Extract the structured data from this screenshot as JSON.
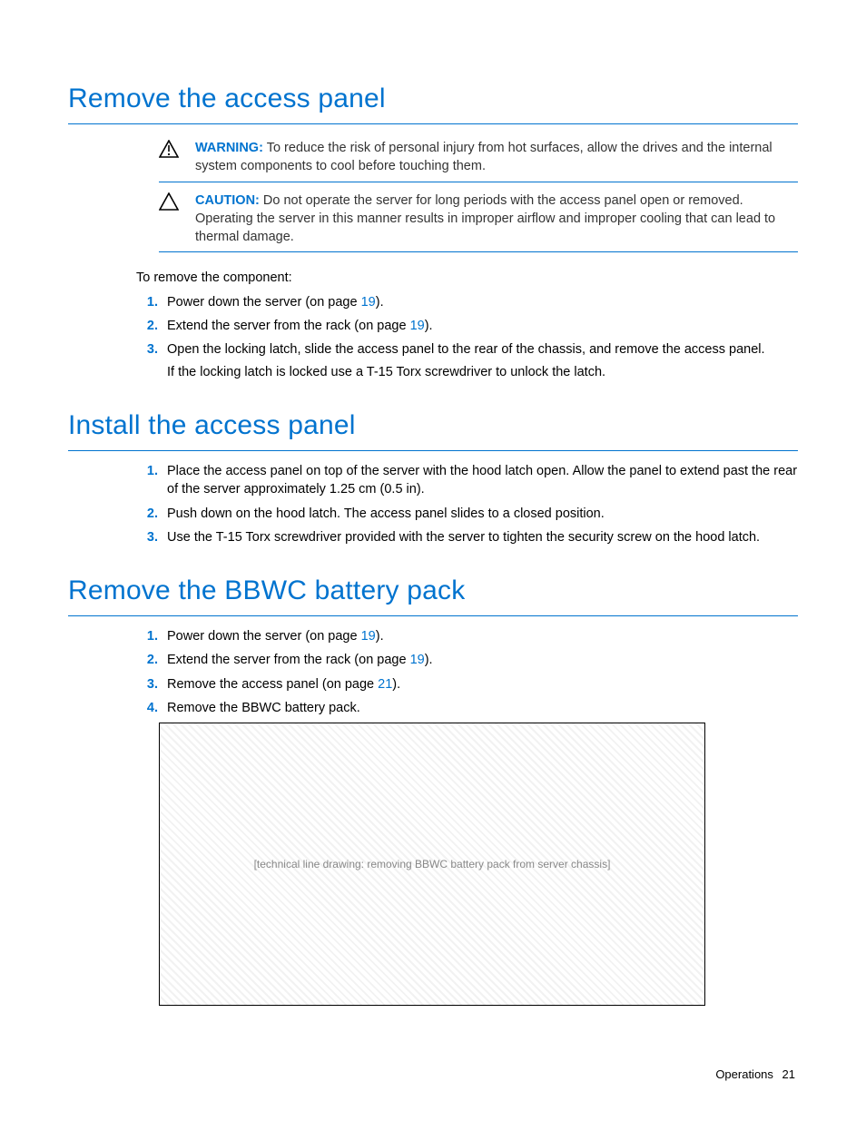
{
  "sections": {
    "remove_panel": {
      "heading": "Remove the access panel",
      "warning_label": "WARNING:",
      "warning_text": "To reduce the risk of personal injury from hot surfaces, allow the drives and the internal system components to cool before touching them.",
      "caution_label": "CAUTION:",
      "caution_text": "Do not operate the server for long periods with the access panel open or removed. Operating the server in this manner results in improper airflow and improper cooling that can lead to thermal damage.",
      "intro": "To remove the component:",
      "steps": {
        "s1a": "Power down the server (on page ",
        "s1link": "19",
        "s1b": ").",
        "s2a": "Extend the server from the rack (on page ",
        "s2link": "19",
        "s2b": ").",
        "s3a": "Open the locking latch, slide the access panel to the rear of the chassis, and remove the access panel.",
        "s3sub": "If the locking latch is locked use a T-15 Torx screwdriver to unlock the latch."
      }
    },
    "install_panel": {
      "heading": "Install the access panel",
      "steps": {
        "s1": "Place the access panel on top of the server with the hood latch open. Allow the panel to extend past the rear of the server approximately 1.25 cm (0.5 in).",
        "s2": "Push down on the hood latch. The access panel slides to a closed position.",
        "s3": "Use the T-15 Torx screwdriver provided with the server to tighten the security screw on the hood latch."
      }
    },
    "remove_bbwc": {
      "heading": "Remove the BBWC battery pack",
      "steps": {
        "s1a": "Power down the server (on page ",
        "s1link": "19",
        "s1b": ").",
        "s2a": "Extend the server from the rack (on page ",
        "s2link": "19",
        "s2b": ").",
        "s3a": "Remove the access panel (on page ",
        "s3link": "21",
        "s3b": ").",
        "s4": "Remove the BBWC battery pack."
      }
    }
  },
  "figure_alt": "[technical line drawing: removing BBWC battery pack from server chassis]",
  "footer": {
    "label": "Operations",
    "page": "21"
  }
}
